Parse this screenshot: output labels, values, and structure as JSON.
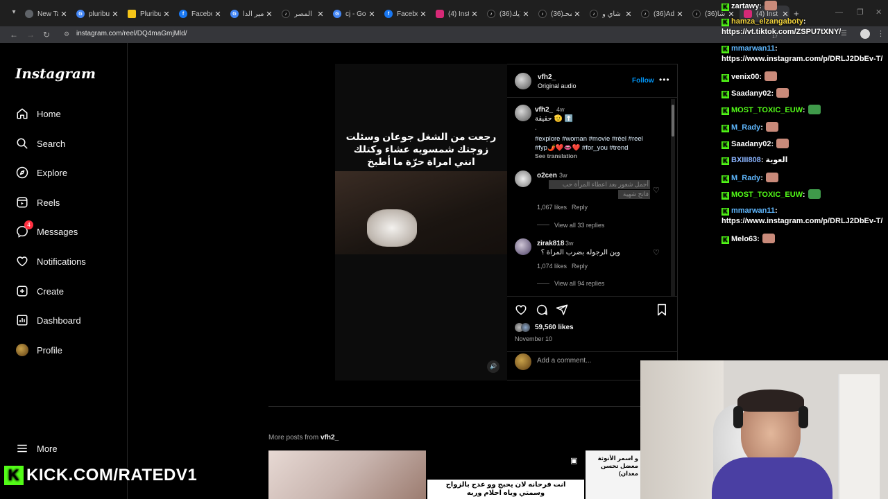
{
  "browser": {
    "tabs": [
      {
        "title": "New Ta",
        "icon": "chrome-icon"
      },
      {
        "title": "pluribu",
        "icon": "google-icon"
      },
      {
        "title": "Pluribu",
        "icon": "imdb-icon"
      },
      {
        "title": "Facebo",
        "icon": "facebook-icon"
      },
      {
        "title": "امير الدا",
        "icon": "google-icon"
      },
      {
        "title": "المصر",
        "icon": "tiktok-icon"
      },
      {
        "title": "cj - Go",
        "icon": "google-icon"
      },
      {
        "title": "Facebo",
        "icon": "facebook-icon"
      },
      {
        "title": "(4) Inst",
        "icon": "instagram-icon"
      },
      {
        "title": "(36)لايك",
        "icon": "tiktok-icon"
      },
      {
        "title": "(36)محـ",
        "icon": "tiktok-icon"
      },
      {
        "title": "شاي و",
        "icon": "tiktok-icon"
      },
      {
        "title": "(36)Adi",
        "icon": "tiktok-icon"
      },
      {
        "title": "(36)شا",
        "icon": "tiktok-icon"
      },
      {
        "title": "(4) Inst",
        "icon": "instagram-icon"
      }
    ],
    "url": "instagram.com/reel/DQ4maGmjMld/",
    "extension_count": "17"
  },
  "sidebar": {
    "logo": "Instagram",
    "items": [
      {
        "label": "Home"
      },
      {
        "label": "Search"
      },
      {
        "label": "Explore"
      },
      {
        "label": "Reels"
      },
      {
        "label": "Messages",
        "badge": "4"
      },
      {
        "label": "Notifications"
      },
      {
        "label": "Create"
      },
      {
        "label": "Dashboard"
      },
      {
        "label": "Profile"
      }
    ],
    "more": "More"
  },
  "video": {
    "caption": "رجعت من الشغل جوعان وسئلت زوجتك شمسويه عشاء وكتلك انني امراة حرّة ما أطبخ"
  },
  "post": {
    "username": "vfh2_",
    "audio": "Original audio",
    "follow": "Follow",
    "caption_user": "vfh2_",
    "caption_time": "4w",
    "caption_text": "حقيقة 🫡 ⬆️",
    "caption_dot": ".",
    "hashtags_line1": "#explore #woman #movie #réel #reel",
    "hashtags_line2": "#fyp🌶️❤️👄❤️ #for_you #trend",
    "see_translation": "See translation",
    "comments": [
      {
        "user": "o2cen",
        "time": "3w",
        "text": "أجمل شعور بعد اعطاء المرأة حب",
        "text2": "فاتح شهية",
        "likes": "1,067 likes",
        "reply": "Reply",
        "view_replies": "View all 33 replies"
      },
      {
        "user": "zirak818",
        "time": "3w",
        "text": "وين الرجوله بضرب المراة ؟",
        "likes": "1,074 likes",
        "reply": "Reply",
        "view_replies": "View all 94 replies"
      }
    ],
    "likes": "59,560 likes",
    "date": "November 10",
    "add_comment": "Add a comment..."
  },
  "more_posts": {
    "label": "More posts from",
    "user": "vfh2_"
  },
  "chat": [
    {
      "user": "zartawy",
      "color": "#ffffff",
      "msg": ":"
    },
    {
      "user": "hamza_elzangaboty",
      "color": "#f0d23c",
      "msg": ":"
    },
    {
      "url": "https://vt.tiktok.com/ZSPU7tXNY/"
    },
    {
      "user": "mmarwan11",
      "color": "#5fb8ff",
      "msg": ":"
    },
    {
      "url": "https://www.instagram.com/p/DRLJ2DbEv-T/"
    },
    {
      "user": "venix00",
      "color": "#ffffff",
      "msg": ":"
    },
    {
      "user": "Saadany02",
      "color": "#ffffff",
      "msg": ":"
    },
    {
      "user": "MOST_TOXIC_EUW",
      "color": "#53fc18",
      "msg": ":"
    },
    {
      "user": "M_Rady",
      "color": "#5fb8ff",
      "msg": ":"
    },
    {
      "user": "Saadany02",
      "color": "#ffffff",
      "msg": ":"
    },
    {
      "user": "BXIII808",
      "color": "#8ab4ff",
      "msg": ": العوية"
    },
    {
      "user": "M_Rady",
      "color": "#5fb8ff",
      "msg": ":"
    },
    {
      "user": "MOST_TOXIC_EUW",
      "color": "#53fc18",
      "msg": ":"
    },
    {
      "user": "mmarwan11",
      "color": "#5fb8ff",
      "msg": ":"
    },
    {
      "url": "https://www.instagram.com/p/DRLJ2DbEv-T/"
    },
    {
      "user": "Melo63",
      "color": "#ffffff",
      "msg": ":"
    }
  ],
  "stream": {
    "kick": "KICK.COM/RATEDV1"
  },
  "thumbs": {
    "t2_text": "انت فرحانه لان يحبج وو عدج بالزواج وسمتي وياه احلام وربه",
    "t3_text": "و اسمر الأنوثة معضل تحسن معدان)"
  },
  "colors": {
    "accent": "#0095f6",
    "kick": "#53fc18",
    "badge": "#ff3040"
  }
}
